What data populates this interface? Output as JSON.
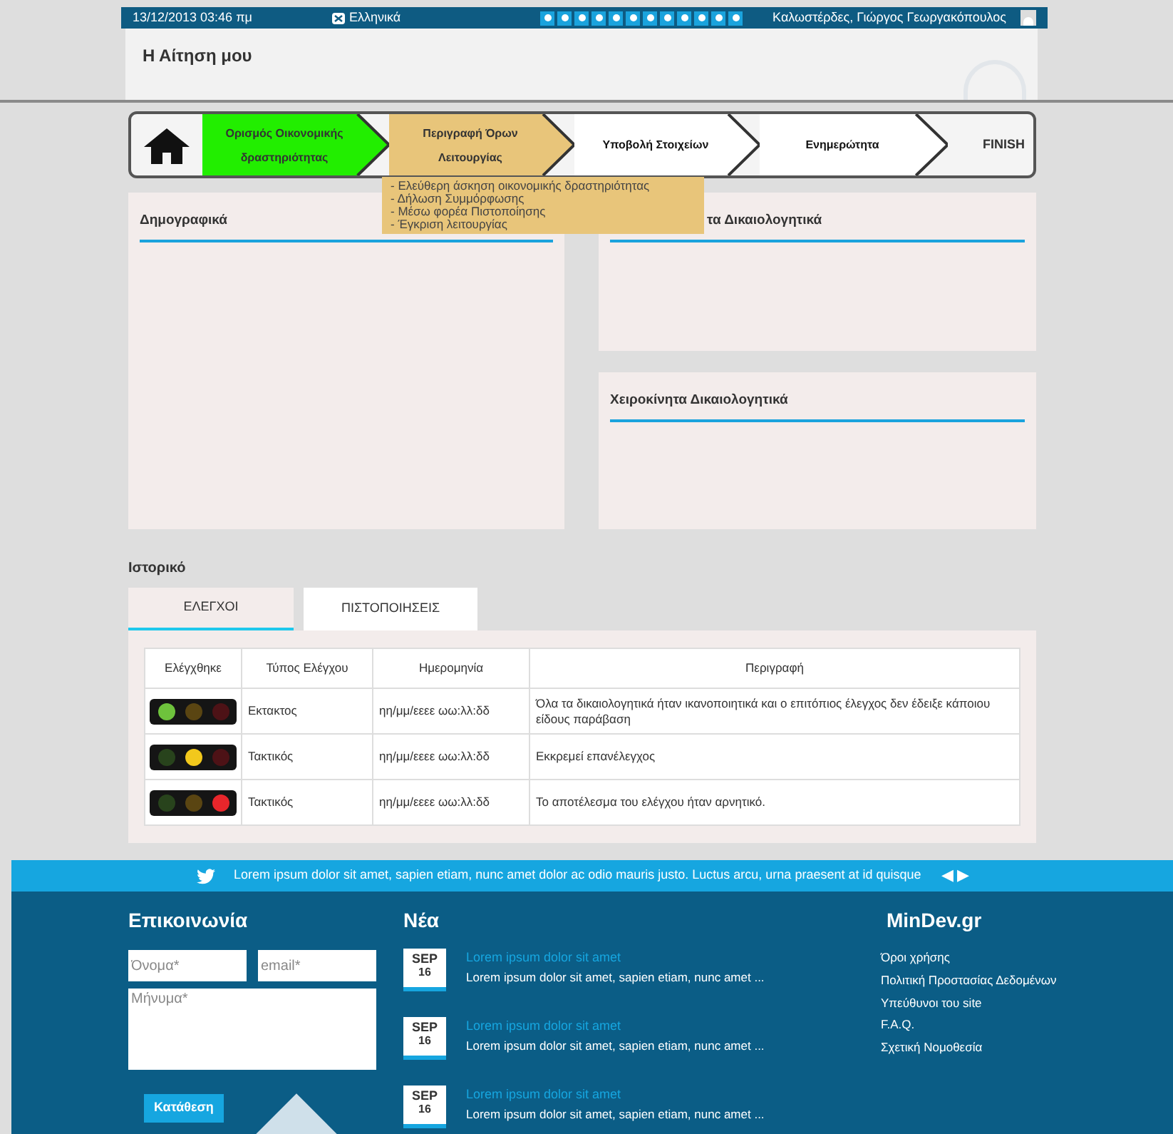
{
  "top_bar": {
    "datetime": "13/12/2013 03:46 πμ",
    "language": "Ελληνικά",
    "user": "Καλωστέρδες, Γιώργος Γεωργακόπουλος"
  },
  "header": {
    "title": "Η Αίτηση μου"
  },
  "wizard": {
    "steps": [
      {
        "label": "Ορισμός Οικονομικής δραστηριότητας",
        "completed": true,
        "selected": false
      },
      {
        "label": "Περιγραφή Όρων Λειτουργίας",
        "completed": false,
        "selected": true
      },
      {
        "label": "Υποβολή Στοιχείων",
        "completed": false,
        "selected": false
      },
      {
        "label": "Ενημερώτητα",
        "completed": false,
        "selected": false
      }
    ],
    "finish": "FINISH",
    "dropdown": [
      "- Ελεύθερη άσκηση οικονομικής δραστηριότητας",
      "- Δήλωση Συμμόρφωσης",
      "- Μέσω φορέα Πιστοποίησης",
      "- Έγκριση λειτουργίας"
    ]
  },
  "panels": [
    {
      "title": "Δημογραφικά"
    },
    {
      "title": "τα Δικαιολογητικά"
    },
    {
      "title": "Χειροκίνητα Δικαιολογητικά"
    }
  ],
  "history": {
    "title": "Ιστορικό",
    "tabs": [
      {
        "label": "ΕΛΕΓΧΟΙ",
        "selected": true
      },
      {
        "label": "ΠΙΣΤΟΠΟΙΗΣΕΙΣ",
        "selected": false
      }
    ],
    "columns": [
      "Ελέγχθηκε",
      "Τύπος Ελέγχου",
      "Ημερομηνία",
      "Περιγραφή"
    ],
    "rows": [
      {
        "color": "#6ec23c",
        "type": "Εκτακτος",
        "date": "ηη/μμ/εεεε ωω:λλ:δδ",
        "description": "Όλα τα δικαιολογητικά ήταν ικανοποιητικά και ο επιτόπιος έλεγχος δεν έδειξε κάποιου είδους παράβαση"
      },
      {
        "color": "#f2c81c",
        "type": "Τακτικός",
        "date": "ηη/μμ/εεεε ωω:λλ:δδ",
        "description": "Εκκρεμεί επανέλεγχος"
      },
      {
        "color": "#e8262b",
        "type": "Τακτικός",
        "date": "ηη/μμ/εεεε ωω:λλ:δδ",
        "description": "Το αποτέλεσμα του ελέγχου ήταν αρνητικό."
      }
    ]
  },
  "ticker": {
    "text": "Lorem ipsum dolor sit amet, sapien etiam, nunc amet dolor ac odio mauris justo. Luctus arcu, urna praesent at id quisque",
    "prev": "◀",
    "next": "▶"
  },
  "footer": {
    "contact": {
      "title": "Επικοινωνία",
      "name_placeholder": "Όνομα*",
      "email_placeholder": "email*",
      "message_placeholder": "Μήνυμα*",
      "submit": "Κατάθεση"
    },
    "news": {
      "title": "Νέα",
      "items": [
        {
          "month": "SEP",
          "day": "16",
          "title": "Lorem ipsum dolor sit amet",
          "excerpt": "Lorem ipsum dolor sit amet, sapien etiam, nunc amet ..."
        },
        {
          "month": "SEP",
          "day": "16",
          "title": "Lorem ipsum dolor sit amet",
          "excerpt": "Lorem ipsum dolor sit amet, sapien etiam, nunc amet ..."
        },
        {
          "month": "SEP",
          "day": "16",
          "title": "Lorem ipsum dolor sit amet",
          "excerpt": "Lorem ipsum dolor sit amet, sapien etiam, nunc amet ..."
        }
      ]
    },
    "site": {
      "title": "MinDev.gr",
      "links": [
        "Όροι χρήσης",
        "Πολιτική Προστασίας Δεδομένων",
        "Υπεύθυνοι του site",
        "F.A.Q.",
        "Σχετική Νομοθεσία"
      ]
    }
  }
}
